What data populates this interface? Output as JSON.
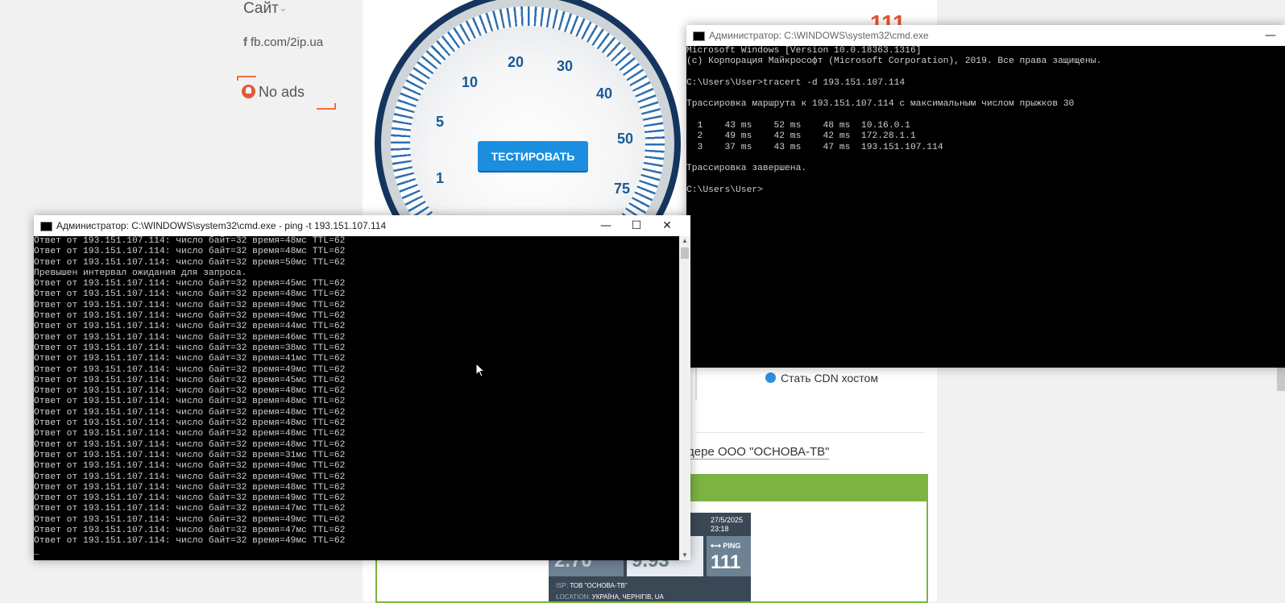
{
  "sidebar": {
    "site_menu": "Сайт",
    "fb_link": "fb.com/2ip.ua",
    "no_ads": "No ads"
  },
  "speedtest": {
    "ping_value": "111",
    "gauge_labels": [
      "1",
      "5",
      "10",
      "20",
      "30",
      "40",
      "50",
      "75"
    ],
    "test_button": "ТЕСТИРОВАТЬ",
    "cdn_link": "Стать CDN хостом",
    "provider_text": "дере ООО \"ОСНОВА-ТВ\""
  },
  "result_card": {
    "date": "27/5/2025",
    "time": "23:18",
    "download": "2.70",
    "upload": "9.93",
    "ping_label": "PING",
    "ping": "111",
    "isp_label": "ISP:",
    "isp": "ТОВ \"ОСНОВА-ТВ\"",
    "location_label": "LOCATION:",
    "location": "УКРАЇНА, ЧЕРНІГІВ, UA"
  },
  "trace_window": {
    "title": "Администратор: C:\\WINDOWS\\system32\\cmd.exe",
    "minimize": "—",
    "lines": [
      "Microsoft Windows [Version 10.0.18363.1316]",
      "(c) Корпорация Майкрософт (Microsoft Corporation), 2019. Все права защищены.",
      "",
      "C:\\Users\\User>tracert -d 193.151.107.114",
      "",
      "Трассировка маршрута к 193.151.107.114 с максимальным числом прыжков 30",
      "",
      "  1    43 ms    52 ms    48 ms  10.16.0.1",
      "  2    49 ms    42 ms    42 ms  172.28.1.1",
      "  3    37 ms    43 ms    47 ms  193.151.107.114",
      "",
      "Трассировка завершена.",
      "",
      "C:\\Users\\User>"
    ]
  },
  "ping_window": {
    "title": "Администратор: C:\\WINDOWS\\system32\\cmd.exe - ping  -t 193.151.107.114",
    "minimize": "—",
    "maximize": "☐",
    "close": "✕",
    "lines": [
      "Ответ от 193.151.107.114: число байт=32 время=48мс TTL=62",
      "Ответ от 193.151.107.114: число байт=32 время=48мс TTL=62",
      "Ответ от 193.151.107.114: число байт=32 время=50мс TTL=62",
      "Превышен интервал ожидания для запроса.",
      "Ответ от 193.151.107.114: число байт=32 время=45мс TTL=62",
      "Ответ от 193.151.107.114: число байт=32 время=48мс TTL=62",
      "Ответ от 193.151.107.114: число байт=32 время=49мс TTL=62",
      "Ответ от 193.151.107.114: число байт=32 время=49мс TTL=62",
      "Ответ от 193.151.107.114: число байт=32 время=44мс TTL=62",
      "Ответ от 193.151.107.114: число байт=32 время=46мс TTL=62",
      "Ответ от 193.151.107.114: число байт=32 время=38мс TTL=62",
      "Ответ от 193.151.107.114: число байт=32 время=41мс TTL=62",
      "Ответ от 193.151.107.114: число байт=32 время=49мс TTL=62",
      "Ответ от 193.151.107.114: число байт=32 время=45мс TTL=62",
      "Ответ от 193.151.107.114: число байт=32 время=48мс TTL=62",
      "Ответ от 193.151.107.114: число байт=32 время=48мс TTL=62",
      "Ответ от 193.151.107.114: число байт=32 время=48мс TTL=62",
      "Ответ от 193.151.107.114: число байт=32 время=48мс TTL=62",
      "Ответ от 193.151.107.114: число байт=32 время=48мс TTL=62",
      "Ответ от 193.151.107.114: число байт=32 время=48мс TTL=62",
      "Ответ от 193.151.107.114: число байт=32 время=31мс TTL=62",
      "Ответ от 193.151.107.114: число байт=32 время=49мс TTL=62",
      "Ответ от 193.151.107.114: число байт=32 время=49мс TTL=62",
      "Ответ от 193.151.107.114: число байт=32 время=48мс TTL=62",
      "Ответ от 193.151.107.114: число байт=32 время=49мс TTL=62",
      "Ответ от 193.151.107.114: число байт=32 время=47мс TTL=62",
      "Ответ от 193.151.107.114: число байт=32 время=49мс TTL=62",
      "Ответ от 193.151.107.114: число байт=32 время=47мс TTL=62",
      "Ответ от 193.151.107.114: число байт=32 время=49мс TTL=62",
      "_"
    ]
  }
}
